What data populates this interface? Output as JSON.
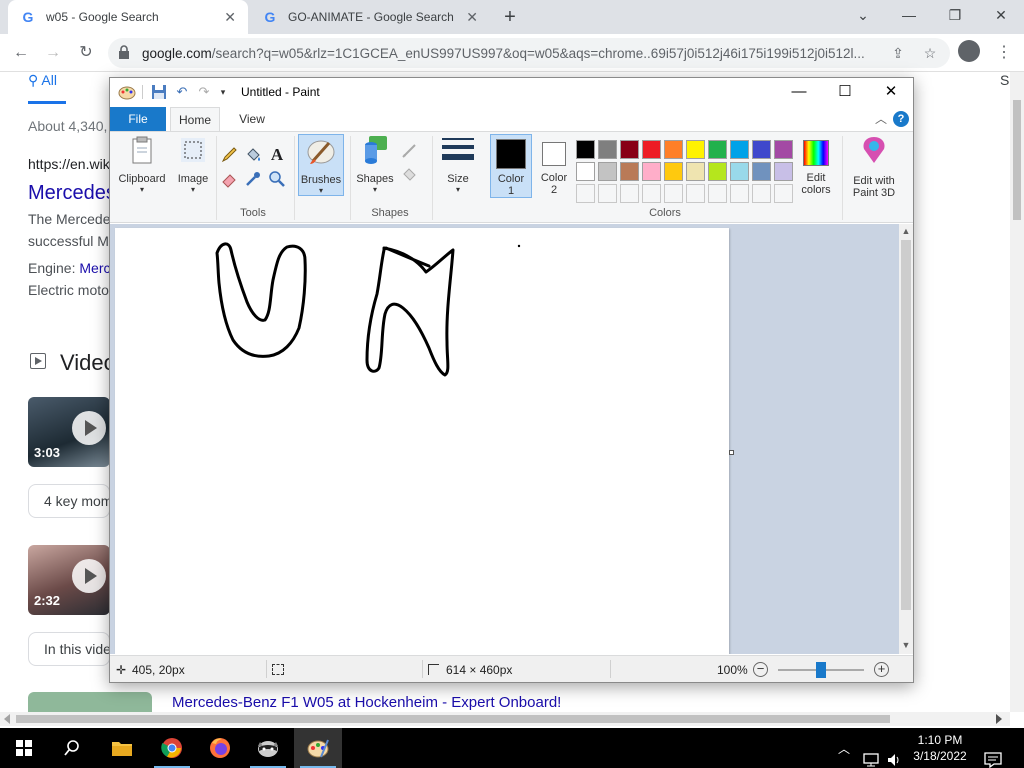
{
  "browser": {
    "tabs": [
      {
        "title": "w05 - Google Search",
        "active": true
      },
      {
        "title": "GO-ANIMATE - Google Search",
        "active": false
      }
    ],
    "url_host": "google.com",
    "url_rest": "/search?q=w05&rlz=1C1GCEA_enUS997US997&oq=w05&aqs=chrome..69i57j0i512j46i175i199i512j0i512l..."
  },
  "google": {
    "tab_all": "All",
    "results_count": "About 4,340,",
    "result_url": "https://en.wik",
    "result_title": "Mercedes",
    "snippet1": "The Mercede",
    "snippet2": "successful M",
    "engine_label": "Engine:",
    "engine_value": "Merc",
    "electric": "Electric moto",
    "videos_heading": "Video",
    "video1_duration": "3:03",
    "key_moments": "4 key mom",
    "video2_duration": "2:32",
    "in_this_video": "In this vide",
    "bottom_result": "Mercedes-Benz F1 W05 at Hockenheim - Expert Onboard!",
    "right_edge_text": "S"
  },
  "paint": {
    "window_title": "Untitled - Paint",
    "tabs": {
      "file": "File",
      "home": "Home",
      "view": "View"
    },
    "ribbon": {
      "clipboard": "Clipboard",
      "image": "Image",
      "tools": "Tools",
      "brushes": "Brushes",
      "shapes_btn": "Shapes",
      "shapes_group": "Shapes",
      "size": "Size",
      "color1": "Color",
      "color1_num": "1",
      "color2": "Color",
      "color2_num": "2",
      "colors_group": "Colors",
      "edit_colors": "Edit",
      "edit_colors2": "colors",
      "paint3d": "Edit with",
      "paint3d2": "Paint 3D"
    },
    "palette_row1": [
      "#000000",
      "#7f7f7f",
      "#880015",
      "#ed1c24",
      "#ff7f27",
      "#fff200",
      "#22b14c",
      "#00a2e8",
      "#3f48cc",
      "#a349a4"
    ],
    "palette_row2": [
      "#ffffff",
      "#c3c3c3",
      "#b97a57",
      "#ffaec9",
      "#ffc90e",
      "#efe4b0",
      "#b5e61d",
      "#99d9ea",
      "#7092be",
      "#c8bfe7"
    ],
    "status": {
      "cursor_pos": "405, 20px",
      "canvas_size": "614 × 460px",
      "zoom": "100%"
    }
  },
  "taskbar": {
    "time": "1:10 PM",
    "date": "3/18/2022"
  },
  "colors": {
    "paint_blue": "#1979ca",
    "canvas_bg": "#c9d3e2",
    "link_blue": "#1a0dab"
  }
}
